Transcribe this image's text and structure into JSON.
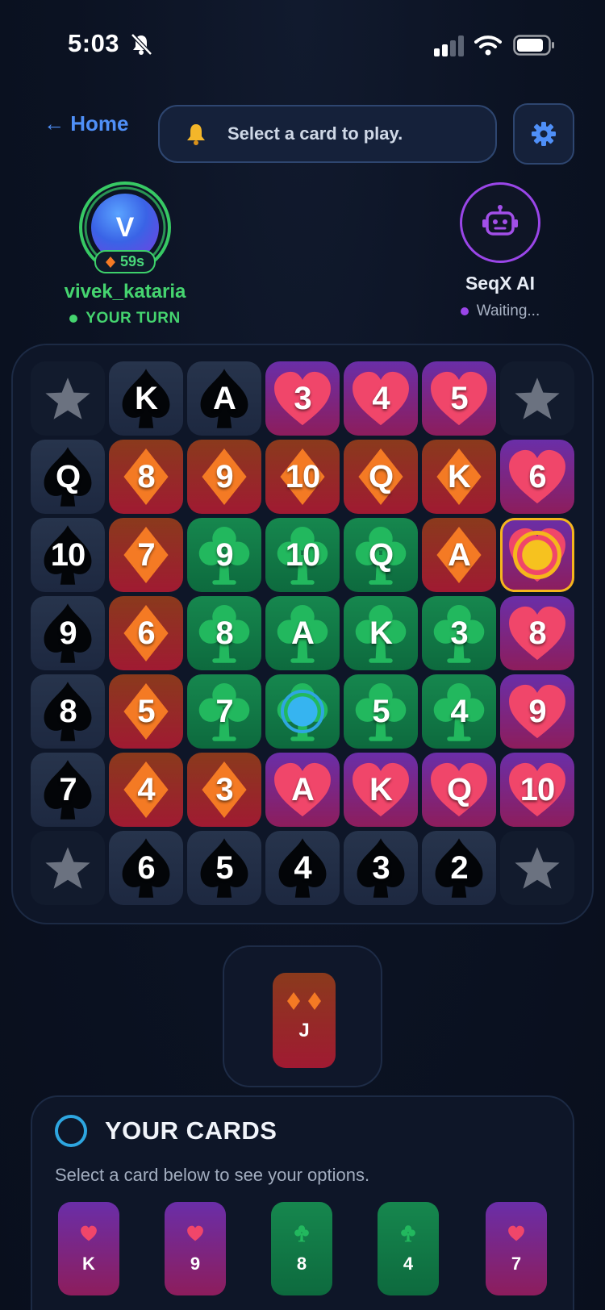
{
  "status_bar": {
    "time": "5:03"
  },
  "header": {
    "home_label": "← Home",
    "notice": "Select a card to play."
  },
  "players": {
    "you": {
      "initial": "V",
      "timer": "59s",
      "name": "vivek_kataria",
      "status": "YOUR TURN"
    },
    "ai": {
      "name": "SeqX AI",
      "status": "Waiting..."
    }
  },
  "colors": {
    "accent_green": "#45d46f",
    "accent_purple": "#9a46e8",
    "accent_blue": "#4f8ff7",
    "highlight_gold": "#f5b61c",
    "chip_blue": "#2ea6e0"
  },
  "board": {
    "rows": [
      [
        {
          "rank": "",
          "suit": "corner"
        },
        {
          "rank": "K",
          "suit": "spades"
        },
        {
          "rank": "A",
          "suit": "spades"
        },
        {
          "rank": "3",
          "suit": "hearts"
        },
        {
          "rank": "4",
          "suit": "hearts"
        },
        {
          "rank": "5",
          "suit": "hearts"
        },
        {
          "rank": "",
          "suit": "corner"
        }
      ],
      [
        {
          "rank": "Q",
          "suit": "spades"
        },
        {
          "rank": "8",
          "suit": "diamonds"
        },
        {
          "rank": "9",
          "suit": "diamonds"
        },
        {
          "rank": "10",
          "suit": "diamonds"
        },
        {
          "rank": "Q",
          "suit": "diamonds"
        },
        {
          "rank": "K",
          "suit": "diamonds"
        },
        {
          "rank": "6",
          "suit": "hearts"
        }
      ],
      [
        {
          "rank": "10",
          "suit": "spades"
        },
        {
          "rank": "7",
          "suit": "diamonds"
        },
        {
          "rank": "9",
          "suit": "clubs"
        },
        {
          "rank": "10",
          "suit": "clubs"
        },
        {
          "rank": "Q",
          "suit": "clubs"
        },
        {
          "rank": "A",
          "suit": "diamonds"
        },
        {
          "rank": "",
          "suit": "hearts",
          "chip": "gold",
          "highlight": true
        }
      ],
      [
        {
          "rank": "9",
          "suit": "spades"
        },
        {
          "rank": "6",
          "suit": "diamonds"
        },
        {
          "rank": "8",
          "suit": "clubs"
        },
        {
          "rank": "A",
          "suit": "clubs"
        },
        {
          "rank": "K",
          "suit": "clubs"
        },
        {
          "rank": "3",
          "suit": "clubs"
        },
        {
          "rank": "8",
          "suit": "hearts"
        }
      ],
      [
        {
          "rank": "8",
          "suit": "spades"
        },
        {
          "rank": "5",
          "suit": "diamonds"
        },
        {
          "rank": "7",
          "suit": "clubs"
        },
        {
          "rank": "",
          "suit": "clubs",
          "chip": "blue"
        },
        {
          "rank": "5",
          "suit": "clubs"
        },
        {
          "rank": "4",
          "suit": "clubs"
        },
        {
          "rank": "9",
          "suit": "hearts"
        }
      ],
      [
        {
          "rank": "7",
          "suit": "spades"
        },
        {
          "rank": "4",
          "suit": "diamonds"
        },
        {
          "rank": "3",
          "suit": "diamonds"
        },
        {
          "rank": "A",
          "suit": "hearts"
        },
        {
          "rank": "K",
          "suit": "hearts"
        },
        {
          "rank": "Q",
          "suit": "hearts"
        },
        {
          "rank": "10",
          "suit": "hearts"
        }
      ],
      [
        {
          "rank": "",
          "suit": "corner"
        },
        {
          "rank": "6",
          "suit": "spades"
        },
        {
          "rank": "5",
          "suit": "spades"
        },
        {
          "rank": "4",
          "suit": "spades"
        },
        {
          "rank": "3",
          "suit": "spades"
        },
        {
          "rank": "2",
          "suit": "spades"
        },
        {
          "rank": "",
          "suit": "corner"
        }
      ]
    ]
  },
  "played_card": {
    "rank": "J",
    "suit": "diamonds"
  },
  "hand": {
    "title": "YOUR CARDS",
    "hint": "Select a card below to see your options.",
    "cards": [
      {
        "rank": "K",
        "suit": "hearts"
      },
      {
        "rank": "9",
        "suit": "hearts"
      },
      {
        "rank": "8",
        "suit": "clubs"
      },
      {
        "rank": "4",
        "suit": "clubs"
      },
      {
        "rank": "7",
        "suit": "hearts"
      }
    ]
  }
}
